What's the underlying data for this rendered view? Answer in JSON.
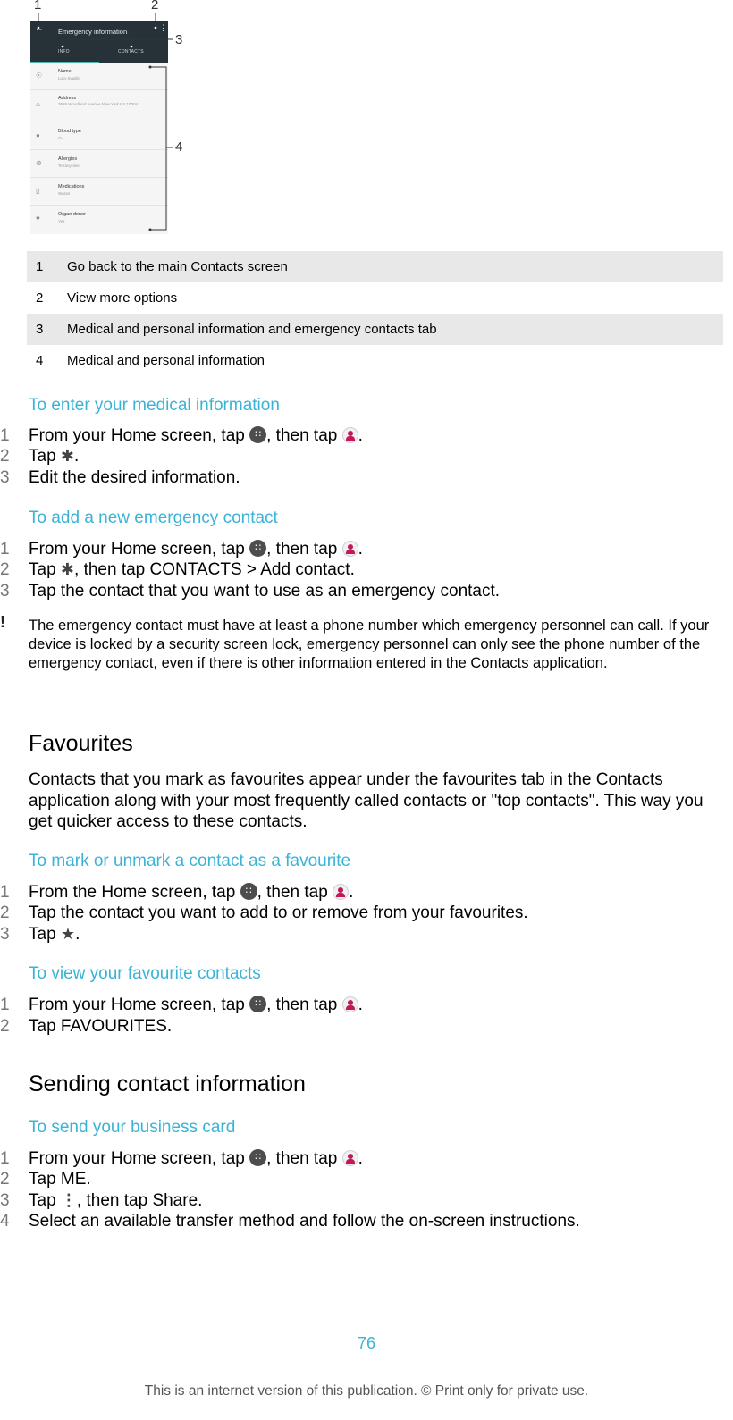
{
  "figure": {
    "callouts": [
      "1",
      "2",
      "3",
      "4"
    ],
    "app_bar": {
      "title": "Emergency information",
      "tabs": [
        "INFO",
        "CONTACTS"
      ]
    },
    "rows": [
      {
        "icon": "person-icon",
        "glyph": "☉",
        "label": "Name",
        "value": "Lucy Ingalls"
      },
      {
        "icon": "home-icon",
        "glyph": "⌂",
        "label": "Address",
        "value": "3688 Woodland Avenue New York NY 10004"
      },
      {
        "icon": "blood-drop-icon",
        "glyph": "●",
        "label": "Blood type",
        "value": "O-"
      },
      {
        "icon": "allergy-icon",
        "glyph": "⊘",
        "label": "Allergies",
        "value": "Tetracycline"
      },
      {
        "icon": "medication-icon",
        "glyph": "▯",
        "label": "Medications",
        "value": "Waran"
      },
      {
        "icon": "heart-icon",
        "glyph": "♥",
        "label": "Organ donor",
        "value": "Yes"
      }
    ]
  },
  "legend": [
    {
      "num": "1",
      "text": "Go back to the main Contacts screen"
    },
    {
      "num": "2",
      "text": "View more options"
    },
    {
      "num": "3",
      "text": "Medical and personal information and emergency contacts tab"
    },
    {
      "num": "4",
      "text": "Medical and personal information"
    }
  ],
  "sections": {
    "enter_medical": {
      "heading": "To enter your medical information",
      "steps": [
        {
          "num": "1",
          "pre": "From your ",
          "bold": "Home screen",
          "mid": ", tap ",
          "mid2": ", then tap ",
          "end": "."
        },
        {
          "num": "2",
          "pre": "Tap ",
          "end": "."
        },
        {
          "num": "3",
          "text": "Edit the desired information."
        }
      ]
    },
    "add_emergency": {
      "heading": "To add a new emergency contact",
      "steps": [
        {
          "num": "1",
          "pre": "From your ",
          "bold": "Home screen",
          "mid": ", tap ",
          "mid2": ", then tap ",
          "end": "."
        },
        {
          "num": "2",
          "pre": "Tap ",
          "mid": ", then tap ",
          "bold1": "CONTACTS",
          "sep": " > ",
          "bold2": "Add contact",
          "end": "."
        },
        {
          "num": "3",
          "text": "Tap the contact that you want to use as an emergency contact."
        }
      ],
      "note": "The emergency contact must have at least a phone number which emergency personnel can call. If your device is locked by a security screen lock, emergency personnel can only see the phone number of the emergency contact, even if there is other information entered in the Contacts application."
    },
    "favourites": {
      "title": "Favourites",
      "intro": "Contacts that you mark as favourites appear under the favourites tab in the Contacts application along with your most frequently called contacts or \"top contacts\". This way you get quicker access to these contacts."
    },
    "mark_favourite": {
      "heading": "To mark or unmark a contact as a favourite",
      "steps": [
        {
          "num": "1",
          "pre": "From the ",
          "bold": "Home screen",
          "mid": ", tap ",
          "mid2": ", then tap ",
          "end": "."
        },
        {
          "num": "2",
          "text": "Tap the contact you want to add to or remove from your favourites."
        },
        {
          "num": "3",
          "pre": "Tap ",
          "end": "."
        }
      ]
    },
    "view_favourites": {
      "heading": "To view your favourite contacts",
      "steps": [
        {
          "num": "1",
          "pre": "From your ",
          "bold": "Home screen",
          "mid": ", tap ",
          "mid2": ", then tap ",
          "end": "."
        },
        {
          "num": "2",
          "pre": "Tap ",
          "bold": "FAVOURITES",
          "end": "."
        }
      ]
    },
    "sending": {
      "title": "Sending contact information",
      "heading": "To send your business card",
      "steps": [
        {
          "num": "1",
          "pre": "From your ",
          "bold": "Home screen",
          "mid": ", tap ",
          "mid2": ", then tap ",
          "end": "."
        },
        {
          "num": "2",
          "pre": "Tap ",
          "bold": "ME",
          "end": "."
        },
        {
          "num": "3",
          "pre": "Tap ",
          "mid": ", then tap ",
          "bold": "Share",
          "end": "."
        },
        {
          "num": "4",
          "text": "Select an available transfer method and follow the on-screen instructions."
        }
      ]
    }
  },
  "page_number": "76",
  "footer": "This is an internet version of this publication. © Print only for private use.",
  "colors": {
    "heading_accent": "#3ab3d6",
    "legend_shade": "#e8e8e8",
    "app_bar": "#263238",
    "contacts_icon": "#c2185b"
  }
}
